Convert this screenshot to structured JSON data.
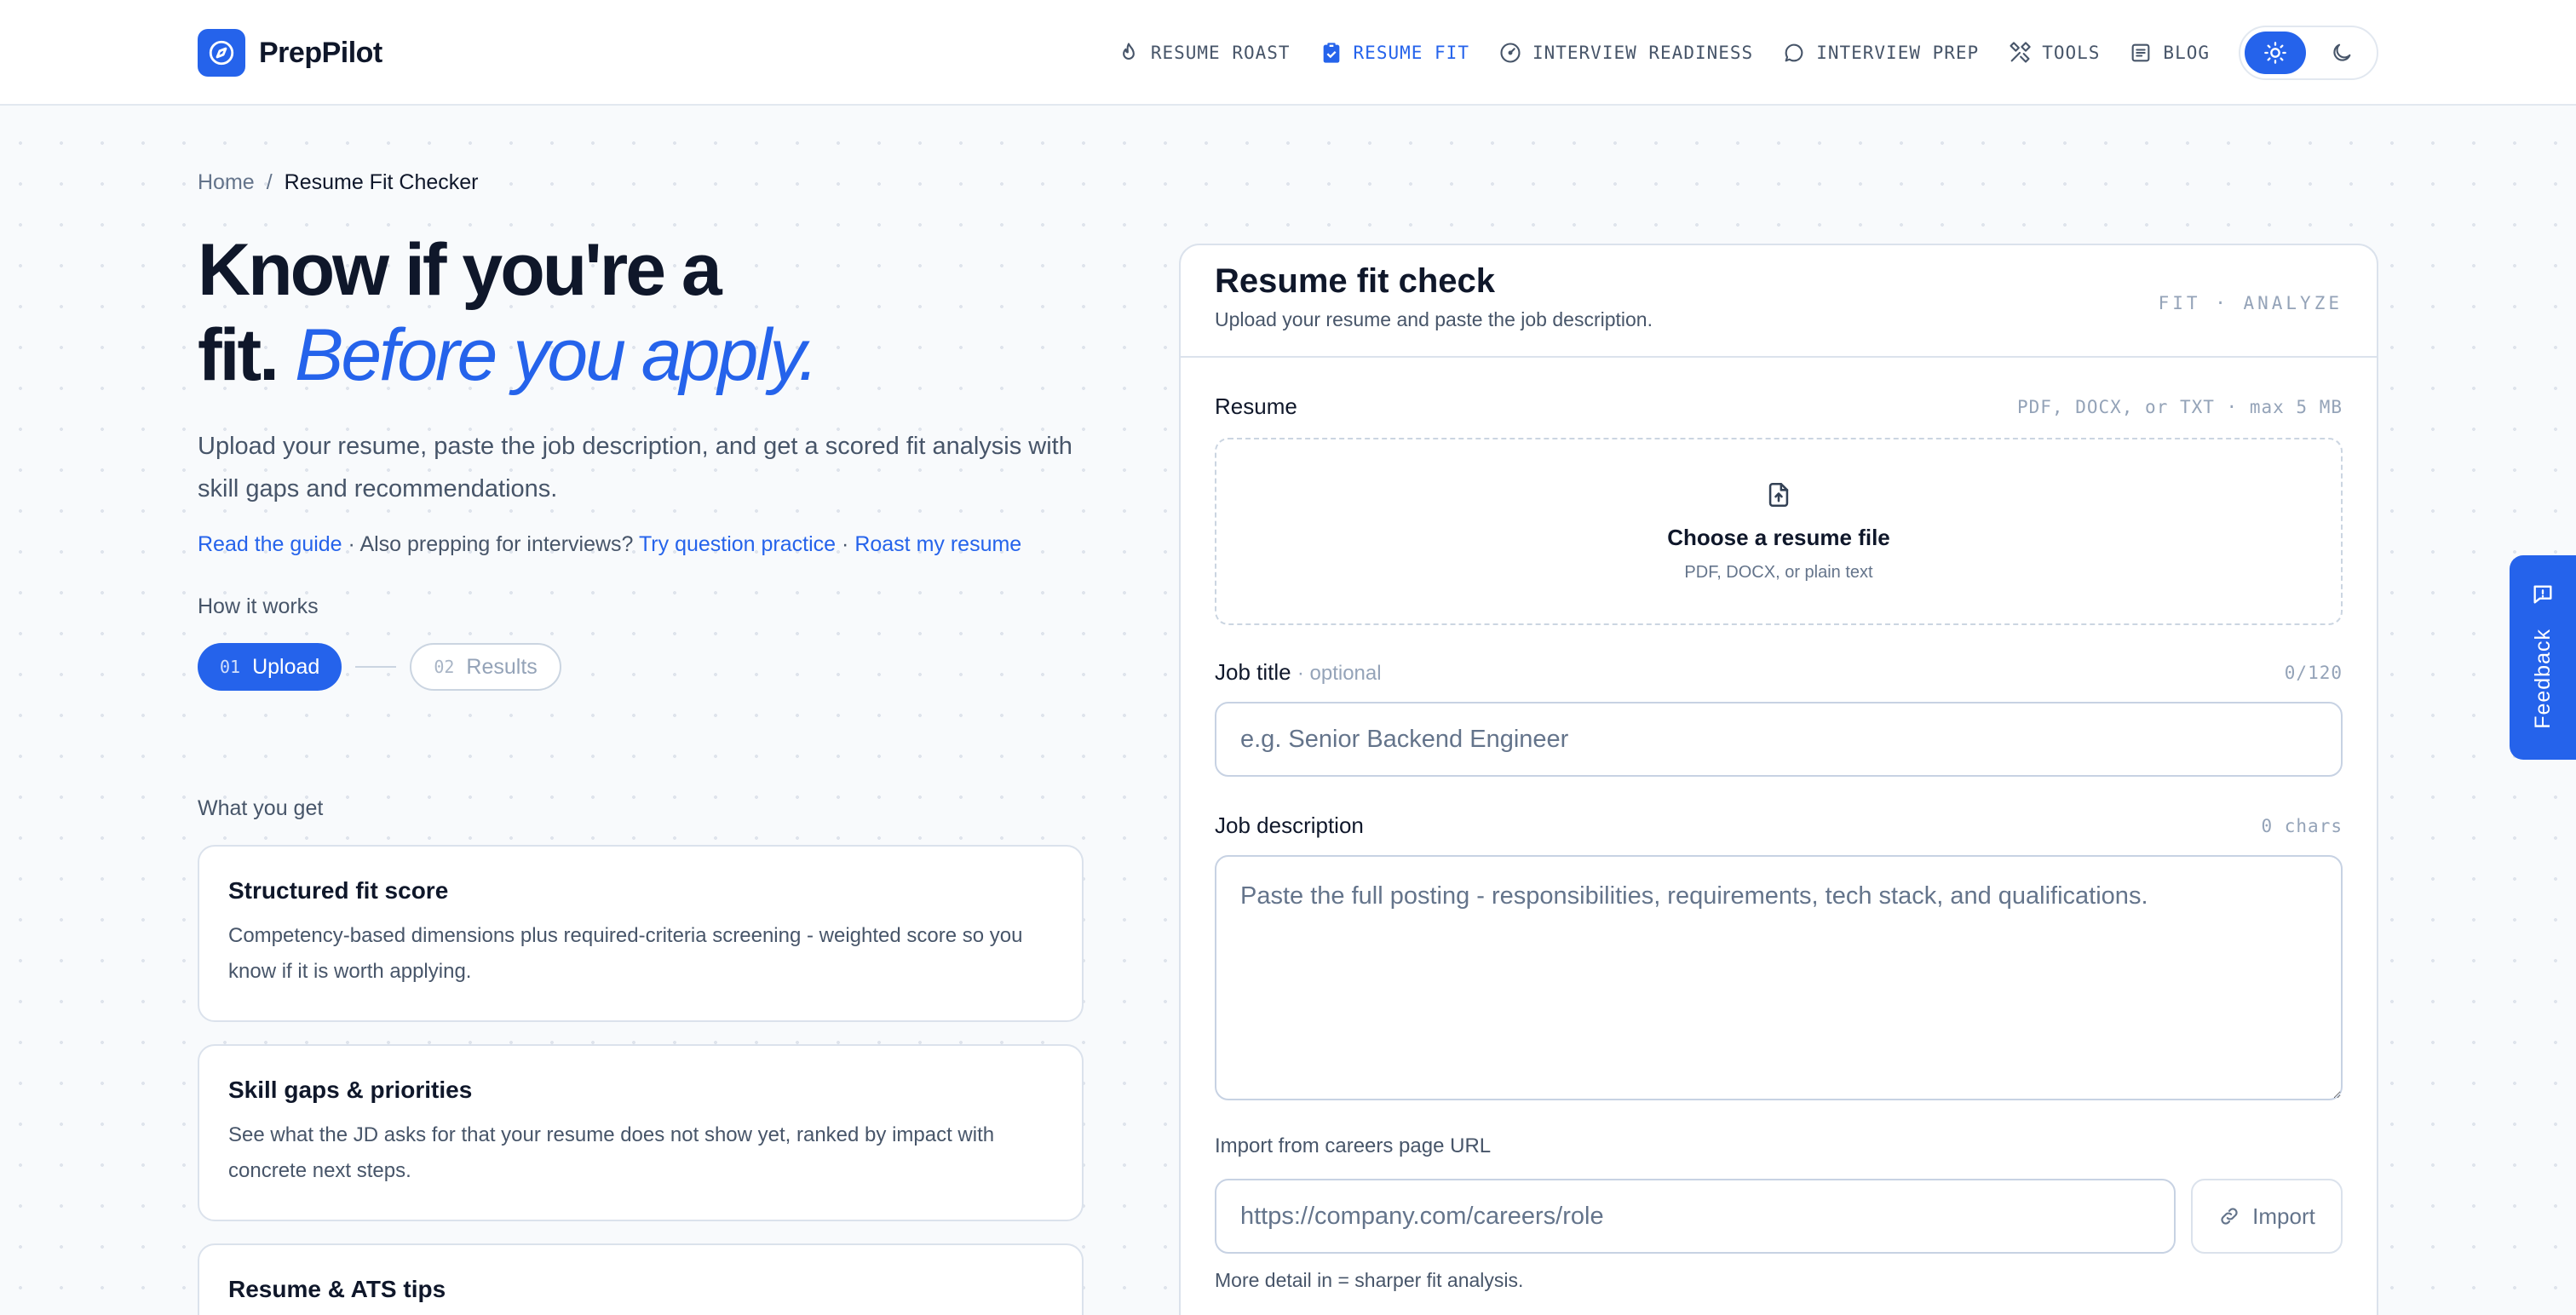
{
  "brand": {
    "name": "PrepPilot",
    "accent": "#2563eb"
  },
  "nav": {
    "items": [
      {
        "label": "RESUME ROAST",
        "icon": "flame-icon",
        "active": false
      },
      {
        "label": "RESUME FIT",
        "icon": "clipboard-check-icon",
        "active": true
      },
      {
        "label": "INTERVIEW READINESS",
        "icon": "gauge-icon",
        "active": false
      },
      {
        "label": "INTERVIEW PREP",
        "icon": "chat-bubble-icon",
        "active": false
      },
      {
        "label": "TOOLS",
        "icon": "tools-icon",
        "active": false
      },
      {
        "label": "BLOG",
        "icon": "article-icon",
        "active": false
      }
    ],
    "theme": {
      "selected": "light",
      "light_icon": "sun-icon",
      "dark_icon": "moon-icon"
    }
  },
  "breadcrumb": {
    "home": "Home",
    "separator": "/",
    "current": "Resume Fit Checker"
  },
  "hero": {
    "line1": "Know if you're a",
    "line2_plain": "fit.",
    "line2_accent": "Before you apply.",
    "lede": "Upload your resume, paste the job description, and get a scored fit analysis with skill gaps and recommendations."
  },
  "links": {
    "guide": "Read the guide",
    "sep1": "·",
    "prompt": "Also prepping for interviews?",
    "practice": "Try question practice",
    "sep2": "·",
    "roast": "Roast my resume"
  },
  "how_it_works": {
    "label": "How it works",
    "steps": [
      {
        "num": "01",
        "label": "Upload",
        "active": true
      },
      {
        "num": "02",
        "label": "Results",
        "active": false
      }
    ]
  },
  "what_you_get": {
    "label": "What you get",
    "cards": [
      {
        "title": "Structured fit score",
        "desc": "Competency-based dimensions plus required-criteria screening - weighted score so you know if it is worth applying."
      },
      {
        "title": "Skill gaps & priorities",
        "desc": "See what the JD asks for that your resume does not show yet, ranked by impact with concrete next steps."
      },
      {
        "title": "Resume & ATS tips",
        "desc": ""
      }
    ]
  },
  "form": {
    "title": "Resume fit check",
    "subtitle": "Upload your resume and paste the job description.",
    "tag": "FIT · ANALYZE",
    "resume": {
      "label": "Resume",
      "meta": "PDF, DOCX, or TXT · max 5 MB",
      "drop_title": "Choose a resume file",
      "drop_sub": "PDF, DOCX, or plain text"
    },
    "job_title": {
      "label": "Job title",
      "optional": "· optional",
      "counter": "0/120",
      "placeholder": "e.g. Senior Backend Engineer",
      "value": ""
    },
    "job_description": {
      "label": "Job description",
      "counter": "0 chars",
      "placeholder": "Paste the full posting - responsibilities, requirements, tech stack, and qualifications.",
      "value": ""
    },
    "import": {
      "label": "Import from careers page URL",
      "placeholder": "https://company.com/careers/role",
      "button": "Import"
    },
    "hint": "More detail in = sharper fit analysis."
  },
  "feedback": {
    "label": "Feedback"
  }
}
